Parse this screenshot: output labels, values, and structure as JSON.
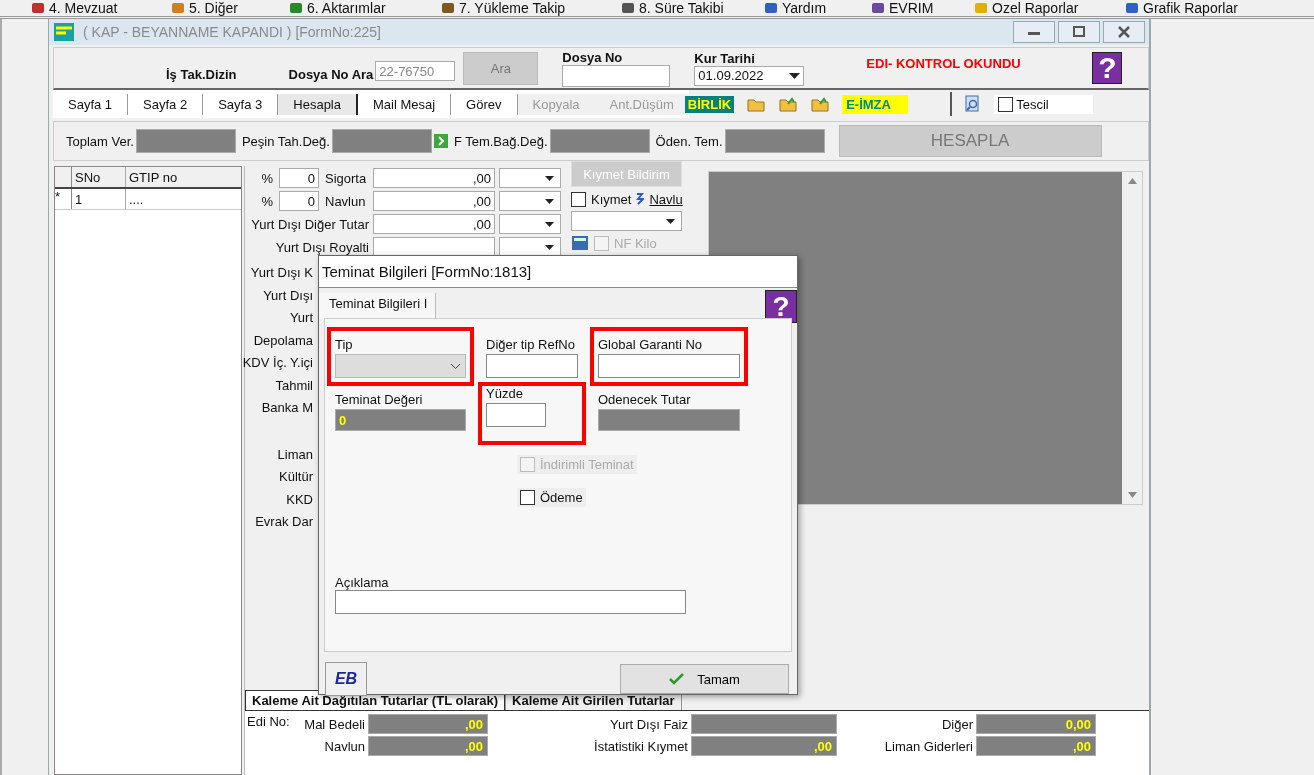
{
  "menu": [
    {
      "label": "4.  Mevzuat"
    },
    {
      "label": "5.  Diğer"
    },
    {
      "label": "6.  Aktarımlar"
    },
    {
      "label": "7.  Yükleme Takip"
    },
    {
      "label": "8. Süre Takibi"
    },
    {
      "label": "Yardım"
    },
    {
      "label": "EVRIM"
    },
    {
      "label": "Ozel Raporlar"
    },
    {
      "label": "Grafik Raporlar"
    }
  ],
  "window": {
    "title": "( KAP - BEYANNAME  KAPANDI ) [FormNo:225]"
  },
  "header": {
    "folder_label": "İş Tak.Dizin",
    "search_label": "Dosya No Ara",
    "search_value": "22-76750",
    "search_button": "Ara",
    "file_no_label": "Dosya No",
    "rate_date_label": "Kur Tarihi",
    "rate_date": "01.09.2022",
    "status": "EDI- KONTROL OKUNDU",
    "help_glyph": "?"
  },
  "tabs": [
    {
      "label": "Sayfa 1",
      "selected": false,
      "disabled": false
    },
    {
      "label": "Sayfa 2",
      "selected": false,
      "disabled": false
    },
    {
      "label": "Sayfa 3",
      "selected": false,
      "disabled": false
    },
    {
      "label": "Hesapla",
      "selected": true,
      "disabled": false
    },
    {
      "label": "Mail Mesaj",
      "selected": false,
      "disabled": false
    },
    {
      "label": "Görev",
      "selected": false,
      "disabled": false
    },
    {
      "label": "Kopyala",
      "selected": false,
      "disabled": true
    },
    {
      "label": "Ant.Düşüm",
      "selected": false,
      "disabled": true
    }
  ],
  "toolbar": {
    "birlik": "BİRLİK",
    "esign": "E-İMZA",
    "tescil": {
      "label": "Tescil",
      "checked": false
    }
  },
  "totals": [
    {
      "label": "Toplam Ver.",
      "kind": "plain"
    },
    {
      "label": "Peşin Tah.Değ.",
      "kind": "plain"
    },
    {
      "label": "F Tem.Bağ.Değ.",
      "kind": "linked"
    },
    {
      "label": "Öden. Tem.",
      "kind": "plain"
    }
  ],
  "calc_button": "HESAPLA",
  "grid": {
    "columns": [
      "SNo",
      "GTIP no"
    ],
    "rows": [
      {
        "marker": "*",
        "cells": [
          "1",
          "...."
        ]
      }
    ]
  },
  "form_rows": [
    {
      "kind": "percent",
      "percent_label": "%",
      "percent": "0",
      "label": "Sigorta",
      "value": ",00"
    },
    {
      "kind": "percent",
      "percent_label": "%",
      "percent": "0",
      "label": "Navlun",
      "value": ",00"
    },
    {
      "kind": "amount",
      "label": "Yurt Dışı Diğer Tutar",
      "value": ",00"
    },
    {
      "kind": "amount",
      "label": "Yurt Dışı Royalti"
    }
  ],
  "covered_labels": [
    [
      "Yurt Dışı K",
      "Yurt Dışı",
      "Yurt",
      "Depolama",
      "KDV İç. Y.içi",
      "Tahmil",
      "Banka M"
    ],
    [
      "Liman",
      "Kültür",
      "KKD",
      "Evrak Dar"
    ]
  ],
  "side": {
    "value_button": "Kıymet Bildirim",
    "value_check": {
      "label": "Kıymet",
      "checked": false
    },
    "freight_link": "Navlu",
    "nf_kilo": {
      "label": "NF Kilo",
      "checked": false,
      "disabled": true
    }
  },
  "dialog": {
    "title": "Teminat Bilgileri [FormNo:1813]",
    "tab": "Teminat Bilgileri I",
    "help_glyph": "?",
    "fields": [
      {
        "label": "Tip",
        "kind": "select",
        "highlighted": true
      },
      {
        "label": "Diğer tip RefNo",
        "kind": "text",
        "highlighted": false
      },
      {
        "label": "Global Garanti No",
        "kind": "text",
        "highlighted": true
      },
      {
        "label": "Teminat Değeri",
        "kind": "readonly",
        "value": "0",
        "highlighted": false
      },
      {
        "label": "Yüzde",
        "kind": "short",
        "highlighted": true
      },
      {
        "label": "Odenecek Tutar",
        "kind": "readonly",
        "highlighted": false
      }
    ],
    "checkboxes": [
      {
        "label": "İndirimli Teminat",
        "checked": false,
        "disabled": true
      },
      {
        "label": "Ödeme",
        "checked": false,
        "disabled": false
      }
    ],
    "note_label": "Açıklama",
    "logo_text": "EB",
    "ok_button": "Tamam"
  },
  "bottom": {
    "tabs": [
      {
        "label": "Kaleme Ait Dağıtılan Tutarlar (TL olarak)",
        "selected": true
      },
      {
        "label": "Kaleme Ait Girilen Tutarlar",
        "selected": false
      }
    ],
    "edi_label": "Edi No:",
    "columns": [
      [
        {
          "label": "Mal Bedeli",
          "value": ",00"
        },
        {
          "label": "Navlun",
          "value": ",00"
        }
      ],
      [
        {
          "label": "Yurt Dışı Faiz"
        },
        {
          "label": "İstatistiki Kıymet",
          "value": ",00"
        }
      ],
      [
        {
          "label": "Diğer",
          "value": "0,00"
        },
        {
          "label": "Liman Giderleri",
          "value": ",00"
        }
      ]
    ]
  }
}
